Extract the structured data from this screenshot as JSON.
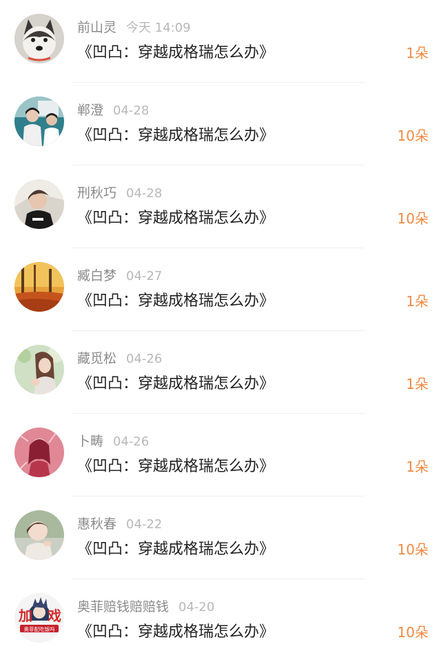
{
  "colors": {
    "accent": "#ef8a44",
    "name": "#8a8a8a",
    "time": "#b8b8b8",
    "title": "#222222"
  },
  "items": [
    {
      "name": "前山灵",
      "time": "今天 14:09",
      "book": "《凹凸：穿越成格瑞怎么办》",
      "count": "1朵",
      "avatar_icon": "husky-avatar"
    },
    {
      "name": "郸澄",
      "time": "04-28",
      "book": "《凹凸：穿越成格瑞怎么办》",
      "count": "10朵",
      "avatar_icon": "couple-avatar"
    },
    {
      "name": "刑秋巧",
      "time": "04-28",
      "book": "《凹凸：穿越成格瑞怎么办》",
      "count": "10朵",
      "avatar_icon": "boy-avatar"
    },
    {
      "name": "臧白梦",
      "time": "04-27",
      "book": "《凹凸：穿越成格瑞怎么办》",
      "count": "1朵",
      "avatar_icon": "autumn-avatar"
    },
    {
      "name": "藏觅松",
      "time": "04-26",
      "book": "《凹凸：穿越成格瑞怎么办》",
      "count": "1朵",
      "avatar_icon": "girl-avatar"
    },
    {
      "name": "卜畴",
      "time": "04-26",
      "book": "《凹凸：穿越成格瑞怎么办》",
      "count": "1朵",
      "avatar_icon": "pink-illustration-avatar"
    },
    {
      "name": "惠秋春",
      "time": "04-22",
      "book": "《凹凸：穿越成格瑞怎么办》",
      "count": "10朵",
      "avatar_icon": "child-avatar"
    },
    {
      "name": "奥菲赔钱赔赔钱",
      "time": "04-20",
      "book": "《凹凸：穿越成格瑞怎么办》",
      "count": "10朵",
      "avatar_icon": "anime-logo-avatar",
      "avatar_badge": "奥菲配吃饭吗"
    }
  ]
}
